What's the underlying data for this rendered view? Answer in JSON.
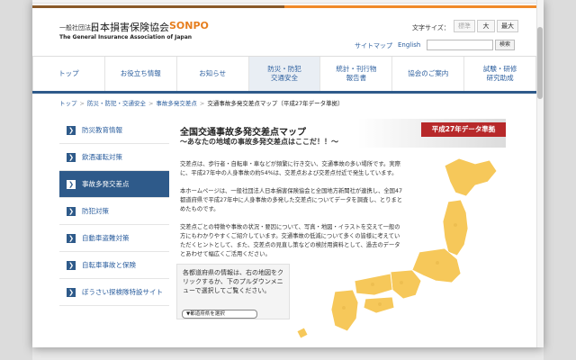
{
  "header": {
    "logo_sub": "一般社団法人",
    "logo_main": "日本損害保険協会",
    "logo_brand": "SONPO",
    "logo_english": "The General Insurance Association of Japan",
    "fontsize_label": "文字サイズ：",
    "fontsize_standard": "標準",
    "fontsize_large": "大",
    "fontsize_xlarge": "最大",
    "sitemap": "サイトマップ",
    "english": "English",
    "search_button": "検索"
  },
  "nav": [
    {
      "label": "トップ"
    },
    {
      "label": "お役立ち情報"
    },
    {
      "label": "お知らせ"
    },
    {
      "label": "防災・防犯\n交通安全"
    },
    {
      "label": "統計・刊行物\n報告書"
    },
    {
      "label": "協会のご案内"
    },
    {
      "label": "試験・研修\n研究助成"
    }
  ],
  "breadcrumb": {
    "items": [
      "トップ",
      "防災・防犯・交通安全",
      "事故多発交差点"
    ],
    "separator": ">",
    "current": "交通事故多発交差点マップ（平成27年データ準拠）"
  },
  "sidebar": [
    {
      "label": "防災教育情報",
      "active": false
    },
    {
      "label": "飲酒運転対策",
      "active": false
    },
    {
      "label": "事故多発交差点",
      "active": true
    },
    {
      "label": "防犯対策",
      "active": false
    },
    {
      "label": "自動車盗難対策",
      "active": false
    },
    {
      "label": "自転車事故と保険",
      "active": false
    },
    {
      "label": "ぼうさい探検隊特設サイト",
      "active": false
    }
  ],
  "main": {
    "title": "全国交通事故多発交差点マップ",
    "subtitle": "～あなたの地域の事故多発交差点はここだ！！～",
    "badge": "平成27年データ準拠",
    "para1": "交差点は、歩行者・自転車・車などが頻繁に行き交い、交通事故の多い場所です。実際に、平成27年中の人身事故の約54%は、交差点および交差点付近で発生しています。",
    "para2": "本ホームページは、一般社団法人日本損害保険協会と全国地方新聞社が連携し、全国47都道府県で平成27年中に人身事故の多発した交差点についてデータを調査し、とりまとめたものです。",
    "para3": "交差点ごとの特徴や事故の状況・要因について、写真・地図・イラストを交えて一般の方にもわかりやすくご紹介しています。交通事故の低減について多くの皆様に考えていただくヒントとして、また、交差点の見直し策などの検討用資料として、過去のデータとあわせて幅広くご活用ください。",
    "instructions": "各都道府県の情報は、右の地図をクリックするか、下のプルダウンメニューで選択してご覧ください。",
    "select_value": "▼都道府県を選択"
  },
  "colors": {
    "nav_accent": "#2e5a8a",
    "badge_red": "#b7292a",
    "brand_orange": "#e67e1e",
    "map_yellow": "#f6c85a"
  }
}
